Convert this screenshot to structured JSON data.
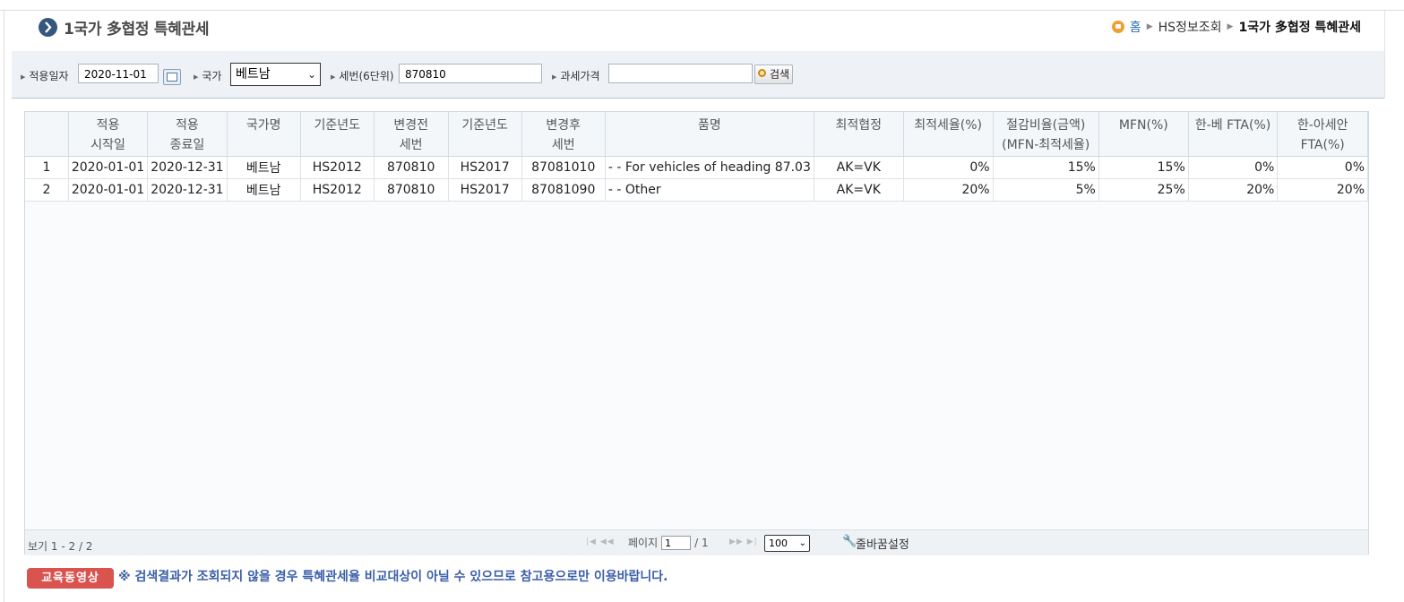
{
  "header": {
    "title": "1국가 多협정 특혜관세",
    "breadcrumb": {
      "home": "홈",
      "section": "HS정보조회",
      "current": "1국가 多협정 특혜관세"
    }
  },
  "search": {
    "date_label": "적용일자",
    "date_value": "2020-11-01",
    "country_label": "국가",
    "country_value": "베트남",
    "hs_label": "세번(6단위)",
    "hs_value": "870810",
    "price_label": "과세가격",
    "price_value": "",
    "search_button": "검색"
  },
  "table": {
    "headers": [
      {
        "l1": "",
        "l2": ""
      },
      {
        "l1": "적용",
        "l2": "시작일"
      },
      {
        "l1": "적용",
        "l2": "종료일"
      },
      {
        "l1": "국가명",
        "l2": ""
      },
      {
        "l1": "기준년도",
        "l2": ""
      },
      {
        "l1": "변경전",
        "l2": "세번"
      },
      {
        "l1": "기준년도",
        "l2": ""
      },
      {
        "l1": "변경후",
        "l2": "세번"
      },
      {
        "l1": "품명",
        "l2": ""
      },
      {
        "l1": "최적협정",
        "l2": ""
      },
      {
        "l1": "최적세율(%)",
        "l2": ""
      },
      {
        "l1": "절감비율(금액)",
        "l2": "(MFN-최적세율)"
      },
      {
        "l1": "MFN(%)",
        "l2": ""
      },
      {
        "l1": "한-베 FTA(%)",
        "l2": ""
      },
      {
        "l1": "한-아세안",
        "l2": "FTA(%)"
      }
    ],
    "rows": [
      [
        "1",
        "2020-01-01",
        "2020-12-31",
        "베트남",
        "HS2012",
        "870810",
        "HS2017",
        "87081010",
        "- - For vehicles of heading 87.03",
        "AK=VK",
        "0%",
        "15%",
        "15%",
        "0%",
        "0%"
      ],
      [
        "2",
        "2020-01-01",
        "2020-12-31",
        "베트남",
        "HS2012",
        "870810",
        "HS2017",
        "87081090",
        "- - Other",
        "AK=VK",
        "20%",
        "5%",
        "25%",
        "20%",
        "20%"
      ]
    ]
  },
  "pager": {
    "records": "보기 1 - 2 / 2",
    "page_label": "페이지",
    "page_value": "1",
    "total_pages": "/ 1",
    "rows_per_page": "100",
    "wrap_setting": "줄바꿈설정"
  },
  "notice": {
    "badge": "교육동영상",
    "text": "※ 검색결과가 조회되지 않을 경우 특혜관세율 비교대상이 아닐 수 있으므로 참고용으로만 이용바랍니다."
  },
  "colors": {
    "accent": "#35577d",
    "rate_red": "#e02020",
    "notice_blue": "#3b5fa8",
    "badge_red": "#d9534f"
  }
}
